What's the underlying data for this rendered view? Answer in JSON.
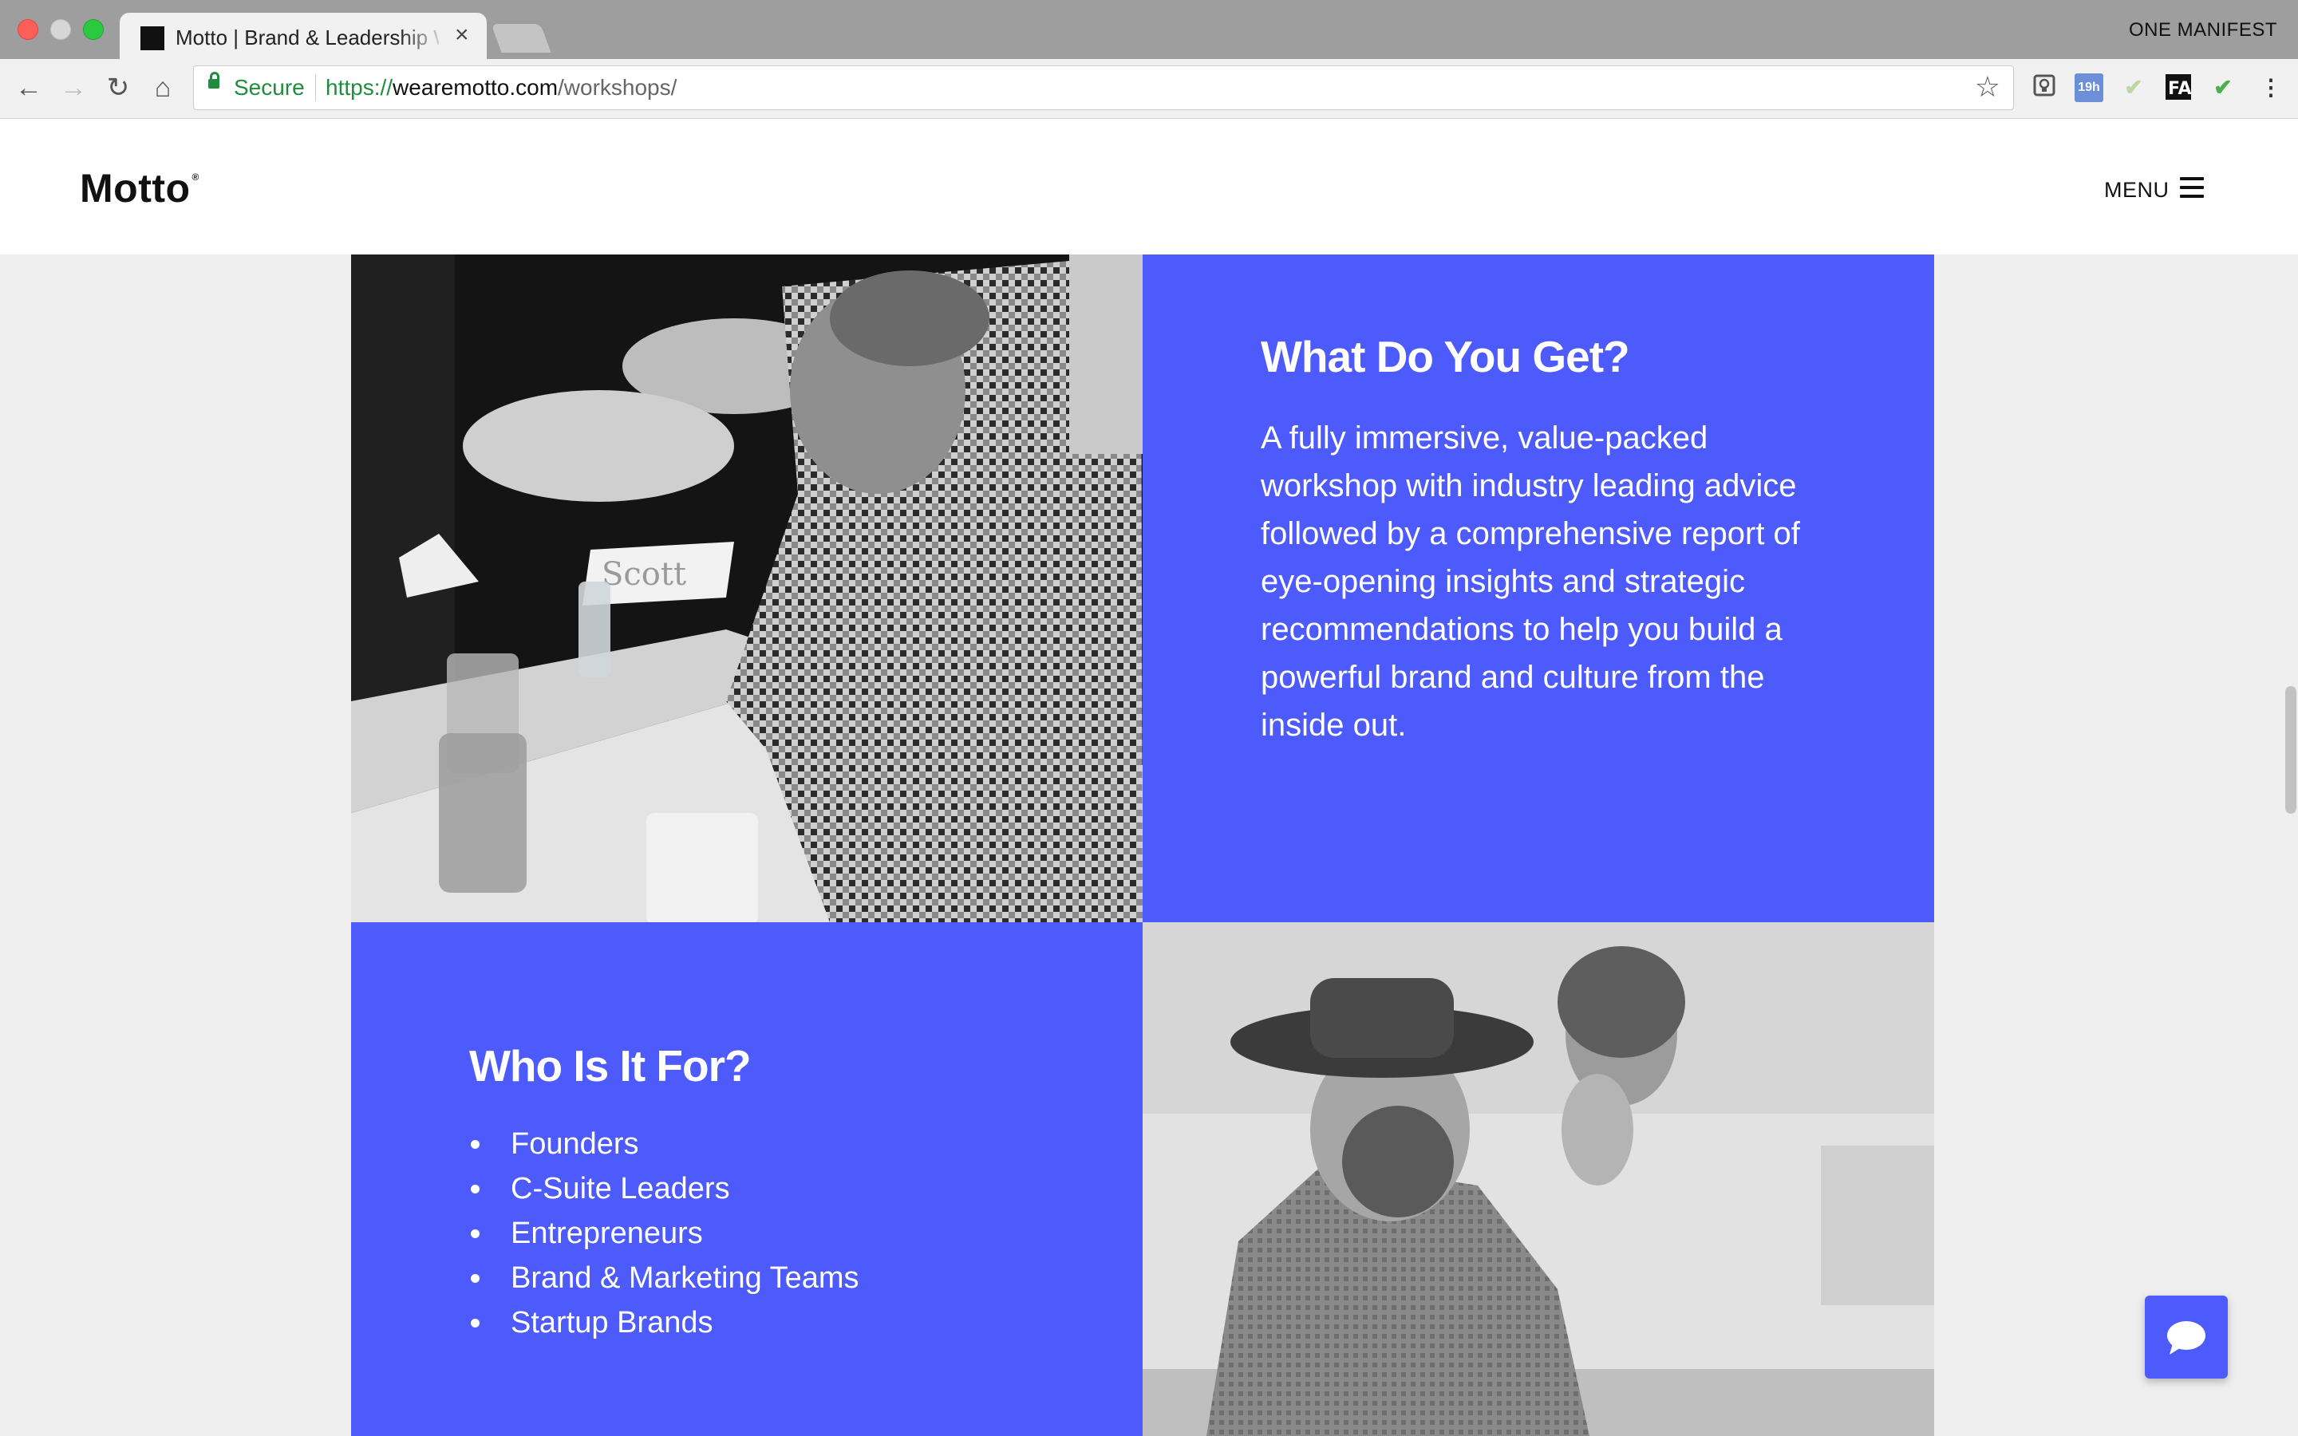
{
  "browser": {
    "tab_title": "Motto | Brand & Leadership Workshops",
    "profile_name": "ONE MANIFEST",
    "secure_label": "Secure",
    "url_scheme": "https://",
    "url_host": "wearemotto.com",
    "url_path": "/workshops/",
    "extensions": [
      "lightbulb",
      "19h",
      "check",
      "FA",
      "check"
    ],
    "calendar_badge": "19h"
  },
  "site": {
    "logo": "Motto",
    "logo_mark": "®",
    "menu_label": "MENU"
  },
  "what_section": {
    "title": "What Do You Get?",
    "body": "A fully immersive, value-packed workshop with industry leading advice followed by a comprehensive report of eye-opening insights and strategic recommendations to help you build a powerful brand and culture from the inside out."
  },
  "who_section": {
    "title": "Who Is It For?",
    "items": [
      "Founders",
      "C-Suite Leaders",
      "Entrepreneurs",
      "Brand & Marketing Teams",
      "Startup Brands"
    ]
  },
  "photo_1": {
    "name_card": "Scott"
  },
  "colors": {
    "accent": "#4d5afc"
  }
}
